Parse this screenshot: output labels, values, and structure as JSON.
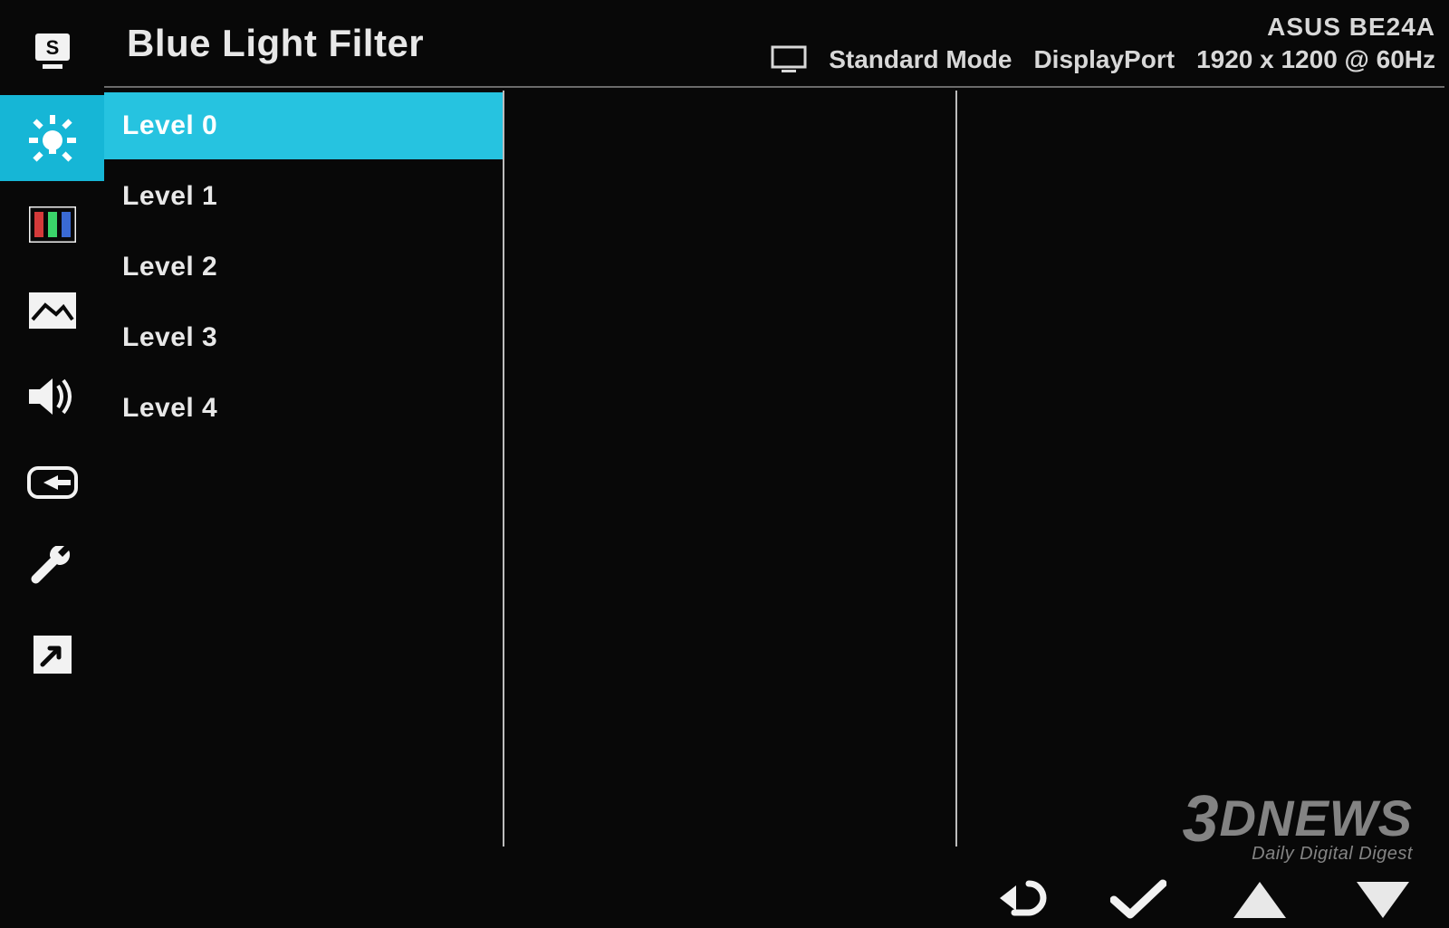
{
  "header": {
    "page_title": "Blue Light Filter",
    "model": "ASUS BE24A",
    "mode": "Standard Mode",
    "input": "DisplayPort",
    "resolution": "1920 x 1200 @ 60Hz"
  },
  "rail": {
    "items": [
      {
        "name": "splendid",
        "icon": "splendid-icon",
        "active": false
      },
      {
        "name": "blue-light",
        "icon": "bulb-icon",
        "active": true
      },
      {
        "name": "color",
        "icon": "color-bars-icon",
        "active": false
      },
      {
        "name": "image",
        "icon": "image-icon",
        "active": false
      },
      {
        "name": "sound",
        "icon": "sound-icon",
        "active": false
      },
      {
        "name": "input",
        "icon": "input-icon",
        "active": false
      },
      {
        "name": "system",
        "icon": "wrench-icon",
        "active": false
      },
      {
        "name": "shortcut",
        "icon": "shortcut-icon",
        "active": false
      }
    ]
  },
  "options": {
    "items": [
      "Level 0",
      "Level 1",
      "Level 2",
      "Level 3",
      "Level 4"
    ],
    "selected_index": 0
  },
  "nav_icons": [
    "back",
    "confirm",
    "up",
    "down"
  ],
  "watermark": {
    "brand_3": "3",
    "brand_d": "D",
    "brand_news": "NEWS",
    "tagline": "Daily Digital Digest"
  }
}
